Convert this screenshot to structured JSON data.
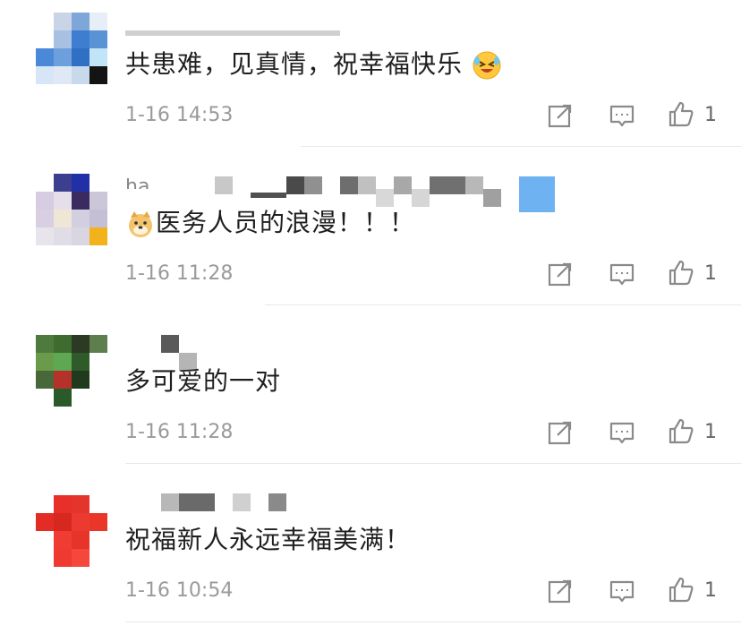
{
  "comments": [
    {
      "text": "共患难，见真情，祝幸福快乐",
      "emoji": "laughing-crying-emoji",
      "time": "1-16 14:53",
      "likes": "1"
    },
    {
      "username": "ha",
      "emoji": "doge-emoji",
      "text": "医务人员的浪漫！！！",
      "time": "1-16 11:28",
      "likes": "1"
    },
    {
      "text": "多可爱的一对",
      "time": "1-16 11:28",
      "likes": "1"
    },
    {
      "text": "祝福新人永远幸福美满！",
      "time": "1-16 10:54",
      "likes": "1"
    }
  ],
  "icons": {
    "share": "share-icon",
    "comment": "comment-icon",
    "like": "thumbs-up-icon"
  },
  "colors": {
    "text": "#1f1f1f",
    "meta": "#9a9a9a",
    "icon": "#8a8a8a"
  }
}
